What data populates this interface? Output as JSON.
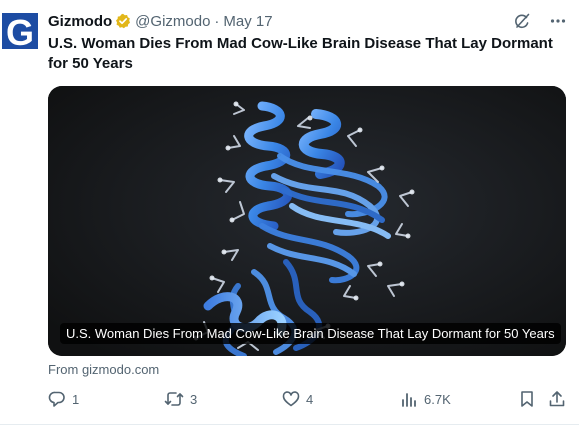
{
  "avatar": {
    "letter": "G",
    "color": "#1d4ca3"
  },
  "header": {
    "author": "Gizmodo",
    "verified_icon": "verified-badge-icon",
    "handle": "@Gizmodo",
    "separator": "·",
    "date": "May 17"
  },
  "top_actions": [
    {
      "icon": "grok-icon"
    },
    {
      "icon": "more-icon",
      "label": "···"
    }
  ],
  "headline": "U.S. Woman Dies From Mad Cow-Like Brain Disease That Lay Dormant for 50 Years",
  "card": {
    "image_icon": "protein-structure-image",
    "caption": "U.S. Woman Dies From Mad Cow-Like Brain Disease That Lay Dormant for 50 Years"
  },
  "source": "From gizmodo.com",
  "actions": {
    "reply": {
      "icon": "reply-icon",
      "count": "1"
    },
    "repost": {
      "icon": "repost-icon",
      "count": "3"
    },
    "like": {
      "icon": "heart-icon",
      "count": "4"
    },
    "views": {
      "icon": "views-icon",
      "count": "6.7K"
    },
    "bookmark": {
      "icon": "bookmark-icon"
    },
    "share": {
      "icon": "share-icon"
    }
  },
  "colors": {
    "text": "#0f1419",
    "muted": "#536471",
    "verified_gold": "#e2b719",
    "card_bg": "#141516"
  }
}
